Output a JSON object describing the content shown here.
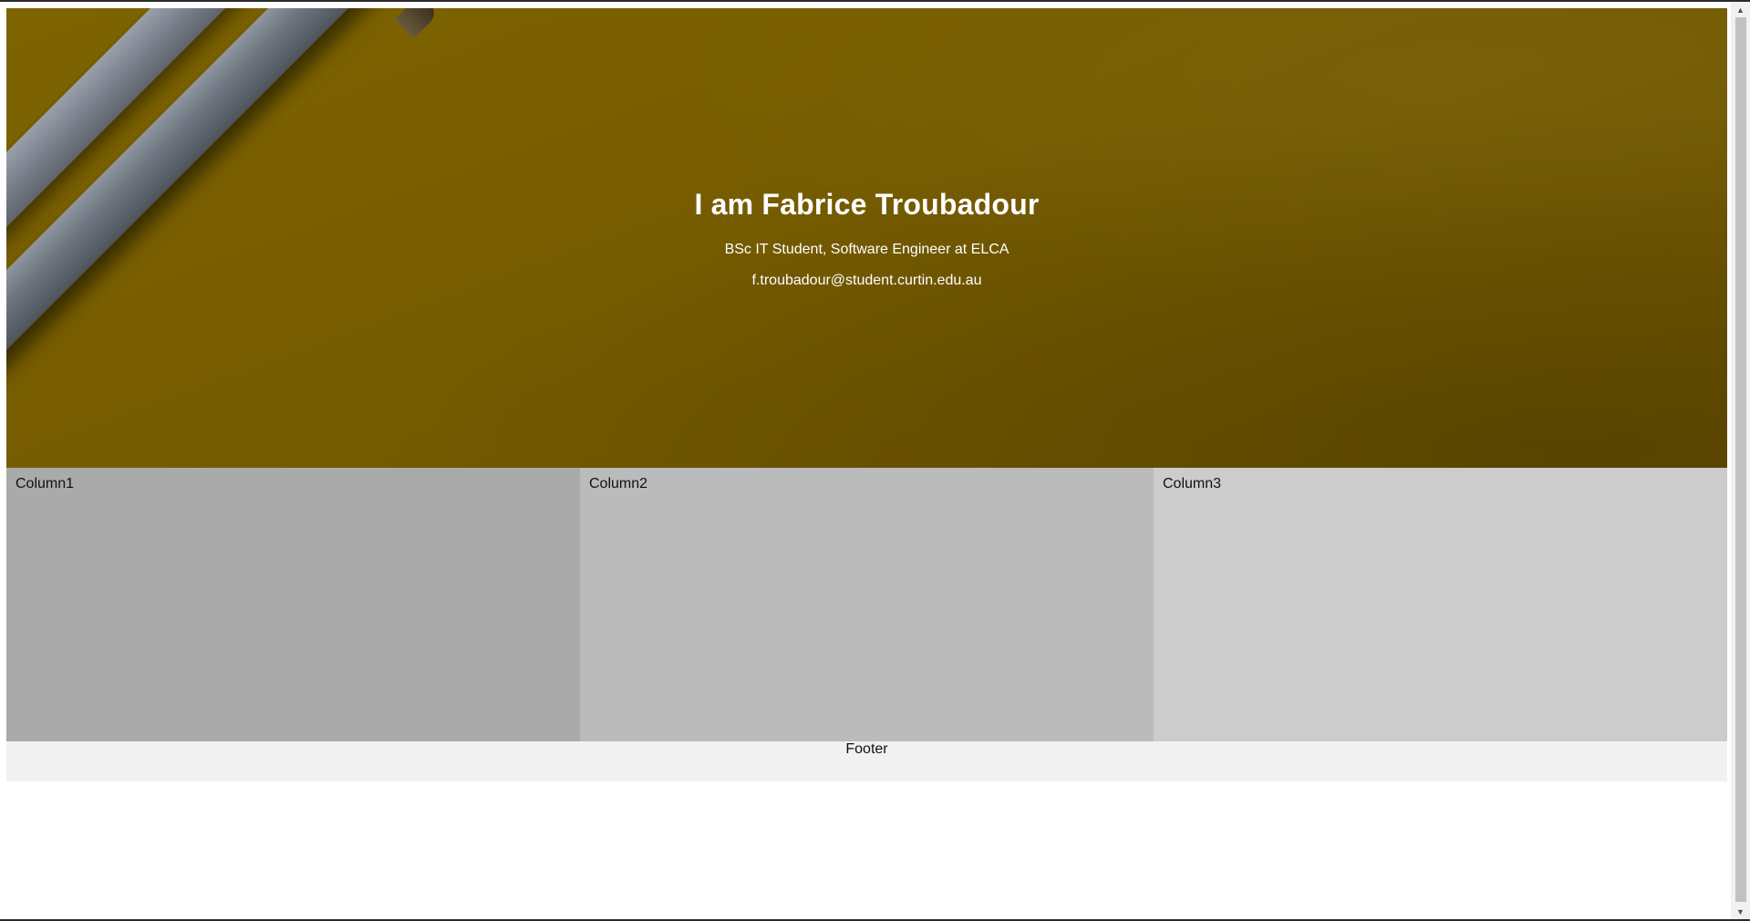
{
  "hero": {
    "title": "I am Fabrice Troubadour",
    "subtitle": "BSc IT Student, Software Engineer at ELCA",
    "email": "f.troubadour@student.curtin.edu.au"
  },
  "columns": [
    {
      "label": "Column1",
      "color": "#aaaaaa"
    },
    {
      "label": "Column2",
      "color": "#bbbbbb"
    },
    {
      "label": "Column3",
      "color": "#cccccc"
    }
  ],
  "footer": {
    "text": "Footer"
  },
  "colors": {
    "hero_bg": "#7a6000",
    "footer_bg": "#f1f1f1"
  },
  "icons": {
    "scroll_up": "triangle-up-icon",
    "scroll_down": "triangle-down-icon"
  }
}
